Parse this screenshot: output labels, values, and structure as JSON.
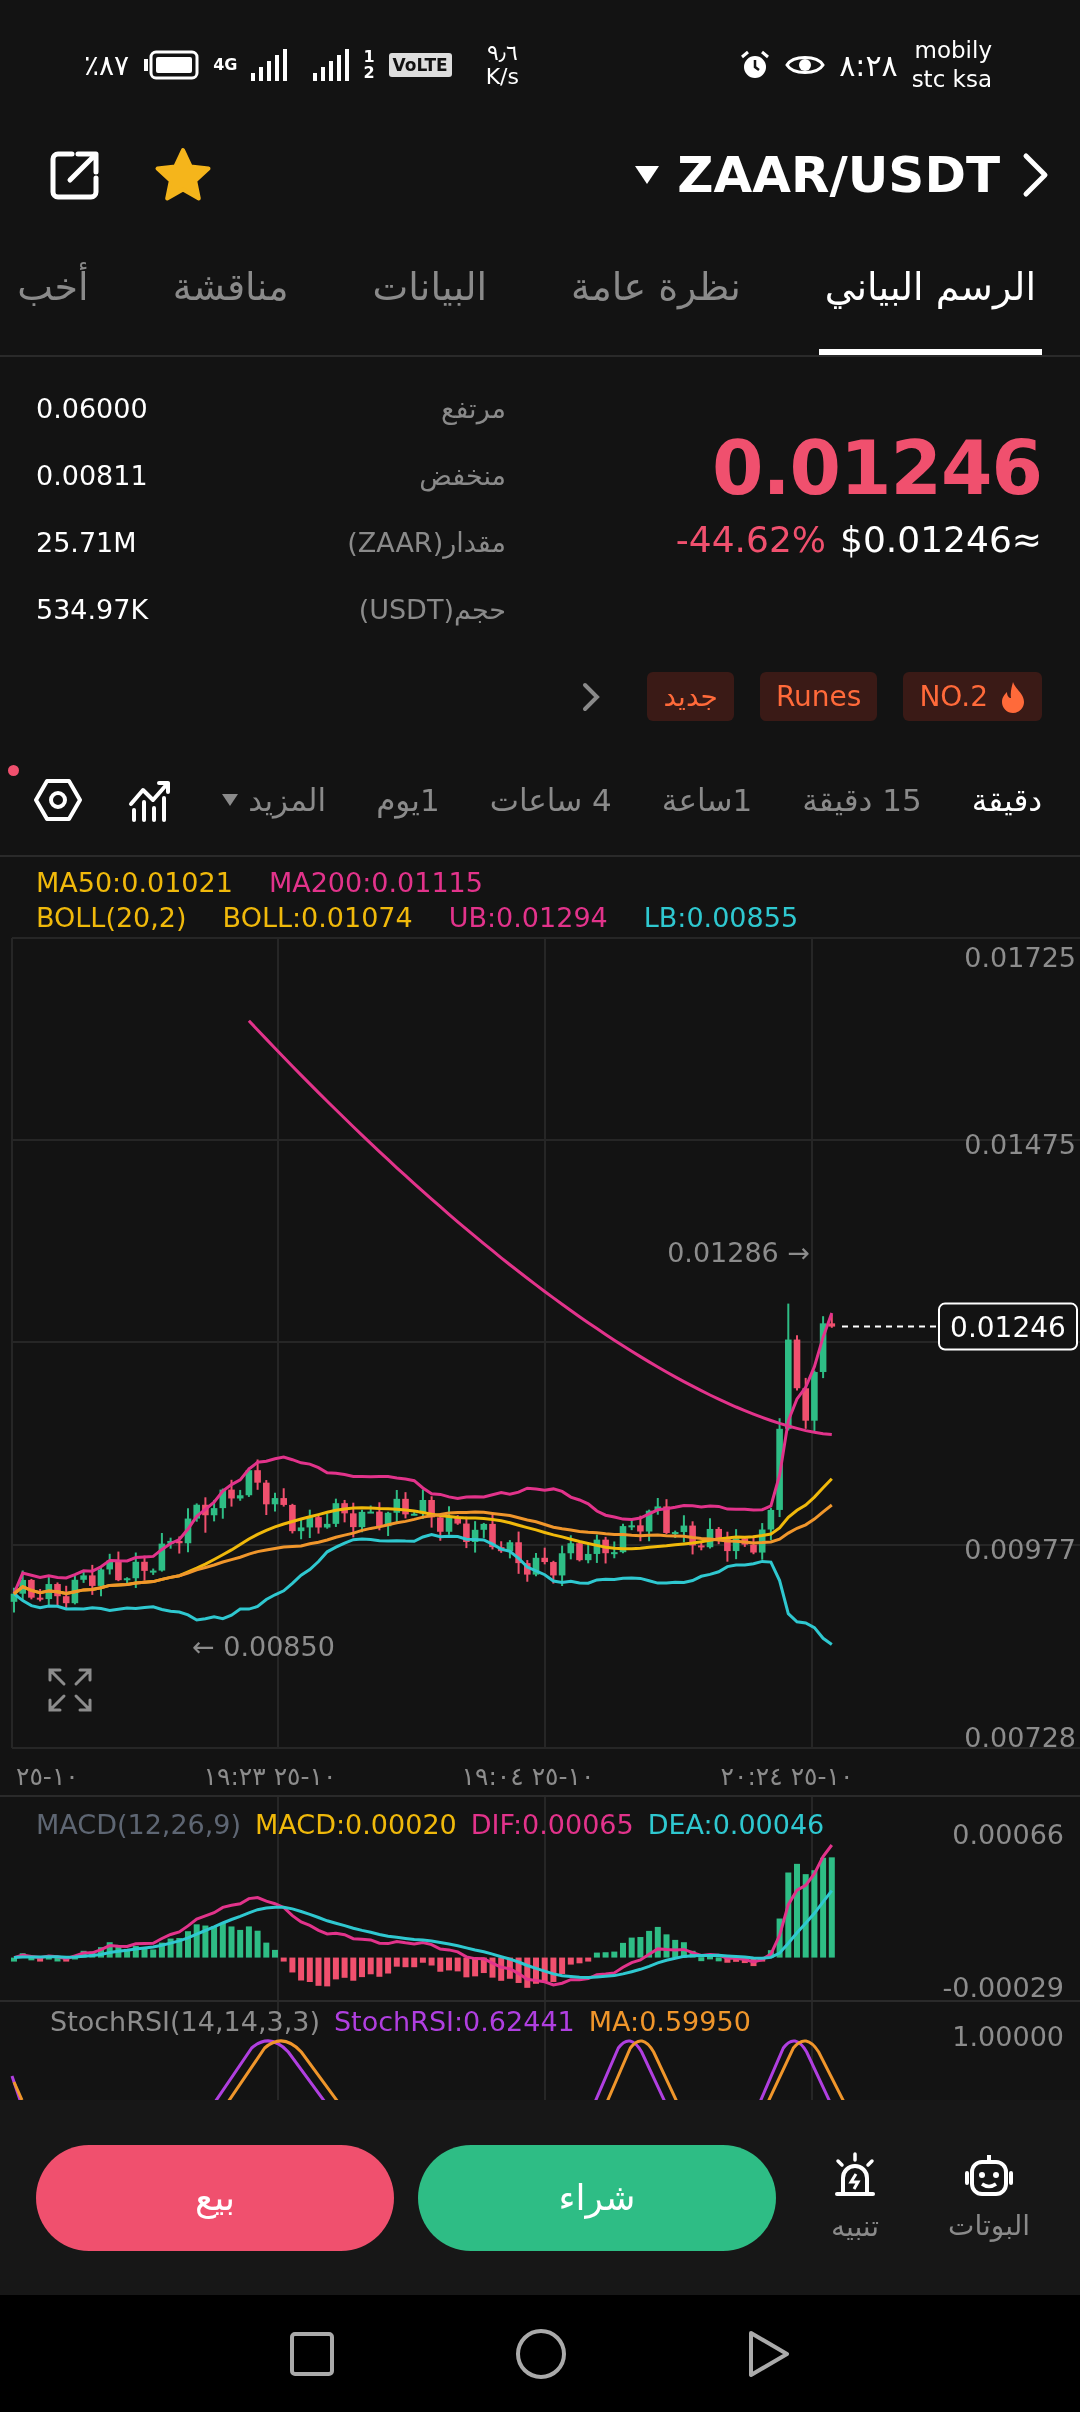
{
  "status_bar": {
    "battery": "٪٨٧",
    "network_type": "4G",
    "sim_slots": [
      "1",
      "2"
    ],
    "volte": "VoLTE",
    "speed_value": "٩٫٦",
    "speed_unit": "K/s",
    "time": "٨:٢٨",
    "carriers": [
      "mobily",
      "stc ksa"
    ]
  },
  "header": {
    "pair": "ZAAR/USDT",
    "starred": true
  },
  "tabs": [
    {
      "label": "الرسم البياني",
      "selected": true
    },
    {
      "label": "نظرة عامة",
      "selected": false
    },
    {
      "label": "البيانات",
      "selected": false
    },
    {
      "label": "مناقشة",
      "selected": false
    },
    {
      "label": "أخب",
      "selected": false
    }
  ],
  "market": {
    "price": "0.01246",
    "change": "-44.62%",
    "fiat_price": "$0.01246≈",
    "stats": [
      {
        "label": "مرتفع",
        "value": "0.06000"
      },
      {
        "label": "منخفض",
        "value": "0.00811"
      },
      {
        "label": "مقدار(ZAAR)",
        "value": "25.71M"
      },
      {
        "label": "حجم(USDT)",
        "value": "534.97K"
      }
    ],
    "tags": [
      {
        "label": "NO.2",
        "kind": "hot"
      },
      {
        "label": "Runes",
        "kind": "plain"
      },
      {
        "label": "جديد",
        "kind": "plain"
      }
    ]
  },
  "timeframes": {
    "items": [
      {
        "label": "دقيقة",
        "selected": true
      },
      {
        "label": "15 دقيقة",
        "selected": false
      },
      {
        "label": "1ساعة",
        "selected": false
      },
      {
        "label": "4 ساعات",
        "selected": false
      },
      {
        "label": "1يوم",
        "selected": false
      }
    ],
    "more": "المزيد",
    "settings_badge": true
  },
  "chart": {
    "legend_rows": [
      [
        {
          "text": "MA200:0.01115",
          "color": "#e2338b"
        },
        {
          "text": "MA50:0.01021",
          "color": "#f0b90b"
        }
      ],
      [
        {
          "text": "LB:0.00855",
          "color": "#2fc8d0"
        },
        {
          "text": "UB:0.01294",
          "color": "#e2338b"
        },
        {
          "text": "BOLL:0.01074",
          "color": "#f0b90b"
        },
        {
          "text": "BOLL(20,2)",
          "color": "#f0b90b"
        }
      ]
    ],
    "price_labels": [
      "0.01725",
      "0.01475",
      "0.00977",
      "0.00728"
    ],
    "high_marker": "0.01286 →",
    "low_marker": "← 0.00850",
    "current_price": "0.01246",
    "time_labels": [
      "٢٠:٢٤ ٢٥-١٠",
      "١٩:٠٤ ٢٥-١٠",
      "١٩:٢٣ ٢٥-١٠",
      "٢٥-١٠"
    ]
  },
  "macd": {
    "legend": [
      {
        "text": "DEA:0.00046",
        "color": "#2fc8d0"
      },
      {
        "text": "DIF:0.00065",
        "color": "#e2338b"
      },
      {
        "text": "MACD:0.00020",
        "color": "#f0b90b"
      },
      {
        "text": "MACD(12,26,9)",
        "color": "#5e6673"
      }
    ],
    "axis_labels": [
      "0.00066",
      "-0.00029"
    ]
  },
  "stoch_rsi": {
    "legend": [
      {
        "text": "MA:0.59950",
        "color": "#f0962b"
      },
      {
        "text": "StochRSI:0.62441",
        "color": "#b03fe0"
      },
      {
        "text": "StochRSI(14,14,3,3)",
        "color": "#8c8c8c"
      }
    ],
    "axis_labels": [
      "1.00000"
    ]
  },
  "action_bar": {
    "tools": [
      {
        "label": "البوتات",
        "kind": "bot"
      },
      {
        "label": "تنبيه",
        "kind": "alert"
      }
    ],
    "buy": "شراء",
    "sell": "بيع"
  }
}
